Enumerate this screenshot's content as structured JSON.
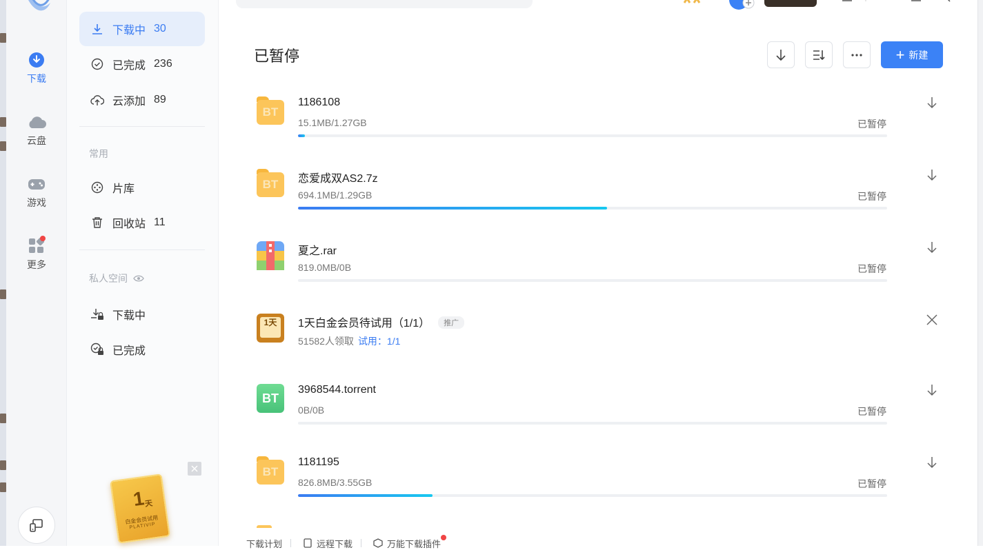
{
  "nav": {
    "items": [
      {
        "label": "下载",
        "icon": "download-circle-icon",
        "active": true
      },
      {
        "label": "云盘",
        "icon": "cloud-icon"
      },
      {
        "label": "游戏",
        "icon": "gamepad-icon"
      },
      {
        "label": "更多",
        "icon": "grid-icon",
        "badge": true
      }
    ]
  },
  "sidebar": {
    "items": [
      {
        "label": "下载中",
        "count": "30"
      },
      {
        "label": "已完成",
        "count": "236"
      },
      {
        "label": "云添加",
        "count": "89"
      }
    ],
    "common_heading": "常用",
    "common_items": [
      {
        "label": "片库",
        "count": ""
      },
      {
        "label": "回收站",
        "count": "11"
      }
    ],
    "private_heading": "私人空间",
    "private_items": [
      {
        "label": "下载中"
      },
      {
        "label": "已完成"
      }
    ],
    "promo": {
      "big": "1",
      "unit": "天",
      "line1": "白金会员试用",
      "line2": "PLATIVIP"
    }
  },
  "main": {
    "title": "已暂停",
    "new_button": "新建",
    "accent_color": "#3b82f6",
    "tasks": [
      {
        "name": "1186108",
        "size": "15.1MB/1.27GB",
        "status": "已暂停",
        "progress": 0.012,
        "type": "bt-folder"
      },
      {
        "name": "恋爱成双AS2.7z",
        "size": "694.1MB/1.29GB",
        "status": "已暂停",
        "progress": 0.525,
        "type": "bt-folder"
      },
      {
        "name": "夏之.rar",
        "size": "819.0MB/0B",
        "status": "已暂停",
        "progress": 0,
        "type": "rar"
      },
      {
        "name": "1天白金会员待试用（1/1）",
        "ad_tag": "推广",
        "sub": "51582人领取",
        "sub_link": "试用：1/1",
        "type": "ad"
      },
      {
        "name": "3968544.torrent",
        "size": "0B/0B",
        "status": "已暂停",
        "progress": 0,
        "type": "torrent"
      },
      {
        "name": "1181195",
        "size": "826.8MB/3.55GB",
        "status": "已暂停",
        "progress": 0.228,
        "type": "bt-folder"
      }
    ],
    "ad_icon_text": "1天"
  },
  "footer": {
    "items": [
      "下载计划",
      "远程下载",
      "万能下载插件"
    ]
  }
}
